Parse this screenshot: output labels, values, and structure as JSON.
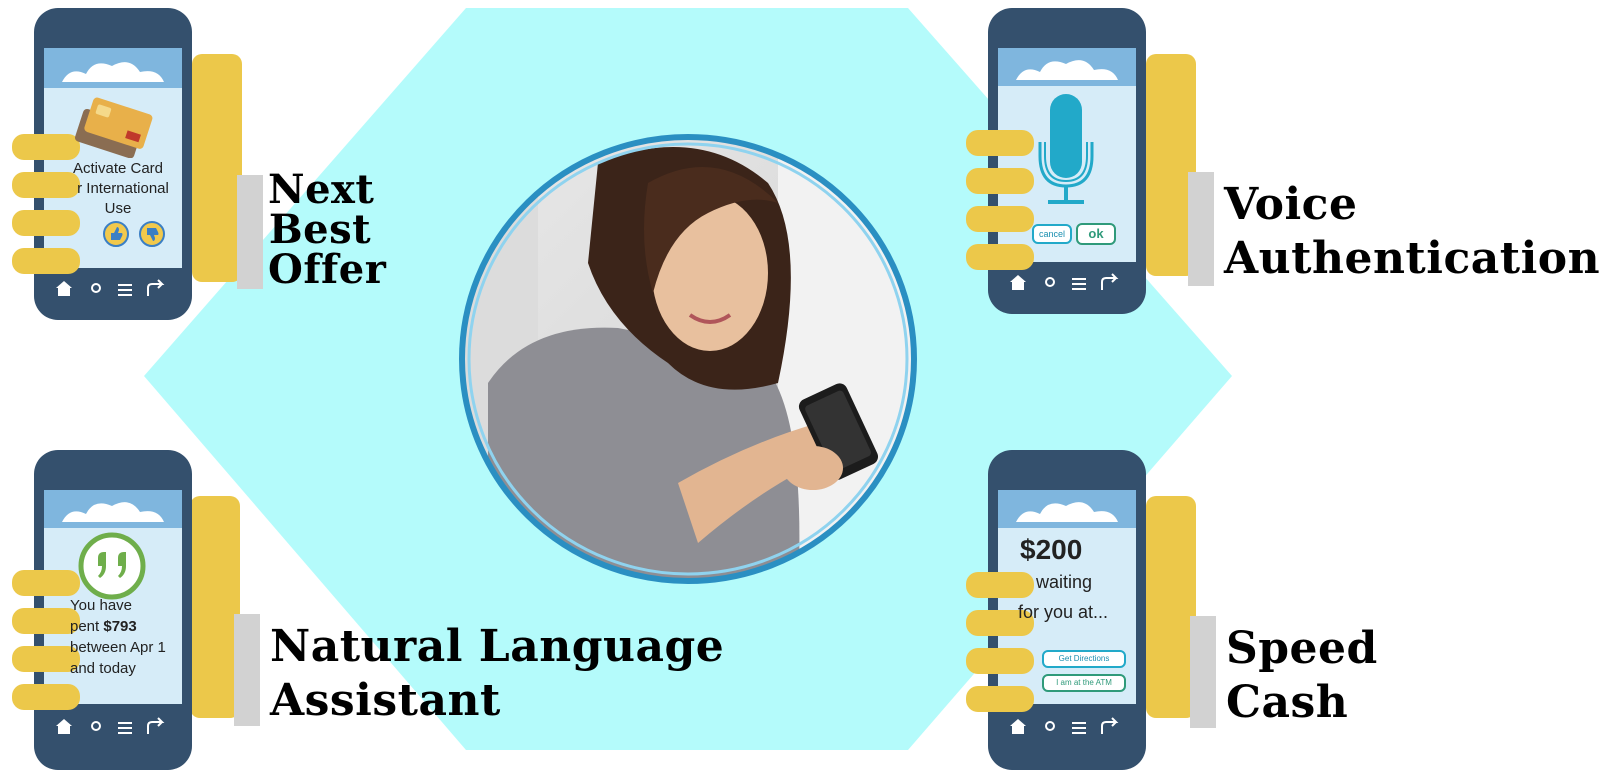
{
  "features": {
    "next_best_offer": {
      "label_line1": "Next",
      "label_line2": "Best",
      "label_line3": "Offer",
      "screen_line1": "Activate Card",
      "screen_line2": "r International",
      "screen_line3": "Use",
      "icons": [
        "credit-card-icon",
        "thumbs-up-icon",
        "thumbs-down-icon"
      ]
    },
    "voice_authentication": {
      "label_line1": "Voice",
      "label_line2": "Authentication",
      "cancel_label": "cancel",
      "ok_label": "ok",
      "icons": [
        "microphone-icon"
      ]
    },
    "natural_language_assistant": {
      "label_line1": "Natural Language",
      "label_line2": "Assistant",
      "screen_line1": "You have",
      "screen_line2_prefix": "pent ",
      "screen_amount": "$793",
      "screen_line3": "between Apr 1",
      "screen_line4": "and today",
      "icons": [
        "quote-bubble-icon"
      ]
    },
    "speed_cash": {
      "label_line1": "Speed",
      "label_line2": "Cash",
      "amount": "$200",
      "screen_line1": "waiting",
      "screen_line2": "for you at...",
      "directions_label": "Get Directions",
      "atm_label": "I am at the ATM"
    }
  },
  "colors": {
    "hexagon": "#b4fbfb",
    "phone_body": "#34506d",
    "screen": "#d6ecf8",
    "sky": "#7fb6de",
    "hand": "#ecc84a",
    "label_bar": "#d2d2d2",
    "accent_blue": "#22a9c9",
    "accent_green": "#2f9a7a"
  }
}
